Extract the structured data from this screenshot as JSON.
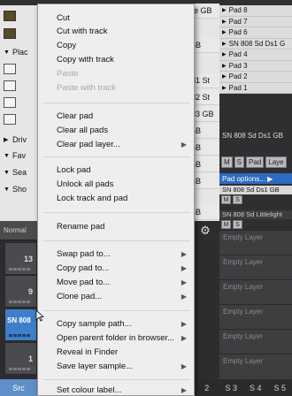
{
  "browser": {
    "rows": [
      {
        "label": "Plac",
        "tri": "▼"
      },
      {
        "label": "Driv",
        "tri": "▶"
      },
      {
        "label": "Fav",
        "tri": "▼"
      },
      {
        "label": "Sea",
        "tri": "▼"
      },
      {
        "label": "Sho",
        "tri": "▼"
      }
    ],
    "right_cells": [
      "pe GB",
      "GB",
      "ol1 St",
      "ol2 St",
      "ol3 GB",
      "GB",
      "GB",
      "GB",
      "GB",
      "GB"
    ],
    "normal_label": "Normal"
  },
  "pads": {
    "items": [
      {
        "num": "13",
        "selected": false
      },
      {
        "num": "",
        "selected": false
      },
      {
        "num": "9",
        "selected": false
      },
      {
        "num": "",
        "selected": true,
        "name": "SN 808"
      },
      {
        "num": "1",
        "selected": false
      }
    ],
    "src_tab": "Src"
  },
  "right_panel": {
    "pad_list": [
      "Pad 8",
      "Pad 7",
      "Pad 6",
      "SN 808 Sd Ds1 G",
      "Pad 4",
      "Pad 3",
      "Pad 2",
      "Pad 1"
    ],
    "pad_name": "SN 808 Sd Ds1 GB",
    "ms_m": "M",
    "ms_s": "S",
    "pad_btn": "Pad",
    "layer_btn": "Laye",
    "pad_options": "Pad options... ▶",
    "layer1_name": "SN 808 Sd Ds1 GB",
    "layer2_name": "SN 808 Sd Littlelight",
    "empty_layer": "Empty Layer",
    "s_tabs": [
      "2",
      "S 3",
      "S 4",
      "S 5"
    ]
  },
  "menu": {
    "items": [
      {
        "label": "Cut",
        "enabled": true,
        "sub": false
      },
      {
        "label": "Cut with track",
        "enabled": true,
        "sub": false
      },
      {
        "label": "Copy",
        "enabled": true,
        "sub": false
      },
      {
        "label": "Copy with track",
        "enabled": true,
        "sub": false
      },
      {
        "label": "Paste",
        "enabled": false,
        "sub": false
      },
      {
        "label": "Paste with track",
        "enabled": false,
        "sub": false
      },
      {
        "label": "Clear pad",
        "enabled": true,
        "sub": false
      },
      {
        "label": "Clear all pads",
        "enabled": true,
        "sub": false
      },
      {
        "label": "Clear pad layer...",
        "enabled": true,
        "sub": true
      },
      {
        "label": "Lock pad",
        "enabled": true,
        "sub": false
      },
      {
        "label": "Unlock all pads",
        "enabled": true,
        "sub": false
      },
      {
        "label": "Lock track and pad",
        "enabled": true,
        "sub": false
      },
      {
        "label": "Rename pad",
        "enabled": true,
        "sub": false
      },
      {
        "label": "Swap pad to...",
        "enabled": true,
        "sub": true
      },
      {
        "label": "Copy pad to...",
        "enabled": true,
        "sub": true
      },
      {
        "label": "Move pad to...",
        "enabled": true,
        "sub": true
      },
      {
        "label": "Clone pad...",
        "enabled": true,
        "sub": true
      },
      {
        "label": "Copy sample path...",
        "enabled": true,
        "sub": true
      },
      {
        "label": "Open parent folder in browser...",
        "enabled": true,
        "sub": true
      },
      {
        "label": "Reveal in Finder",
        "enabled": true,
        "sub": false
      },
      {
        "label": "Save layer sample...",
        "enabled": true,
        "sub": true
      },
      {
        "label": "Set colour label...",
        "enabled": true,
        "sub": true
      }
    ]
  },
  "colors": {
    "accent": "#3f7fc9",
    "menu_bg": "#eeeeee",
    "pad_options_bg": "#2d6ac2"
  }
}
